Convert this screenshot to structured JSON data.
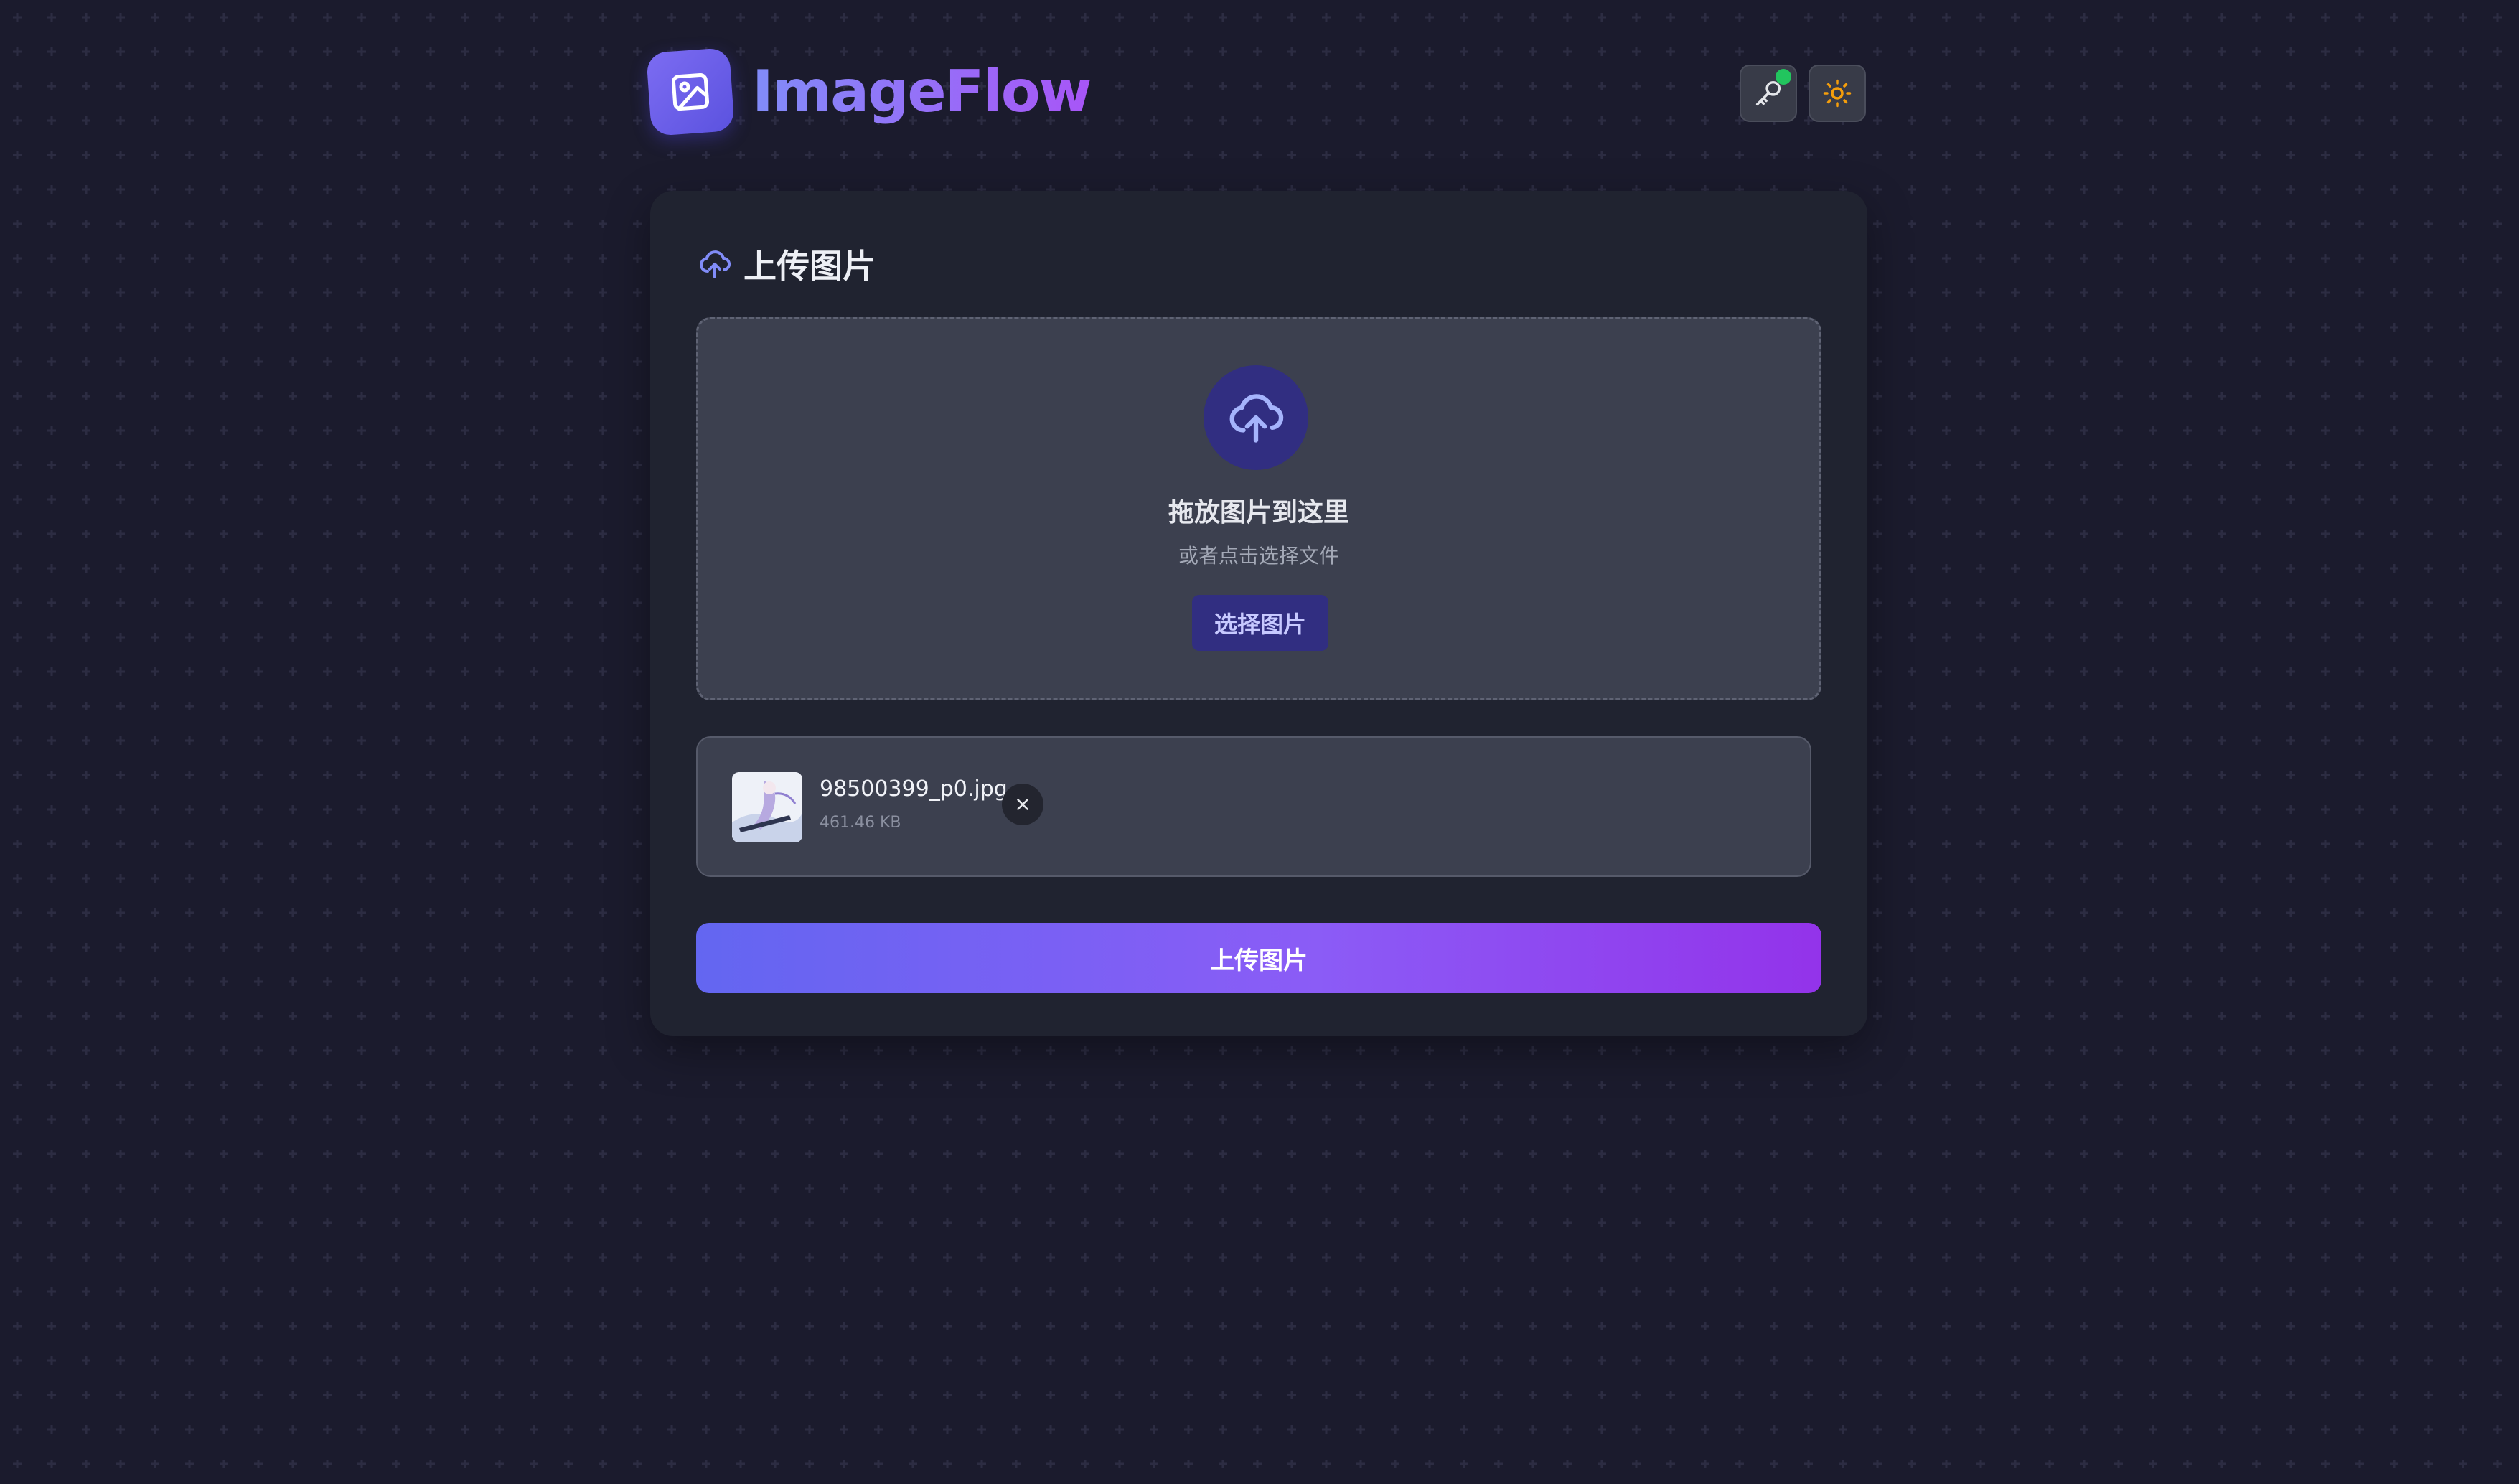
{
  "app": {
    "name": "ImageFlow"
  },
  "header": {
    "api_key_icon": "key-icon",
    "theme_icon": "sun-icon",
    "status_color": "#22c55e"
  },
  "upload_card": {
    "title": "上传图片",
    "title_icon": "cloud-upload-icon",
    "dropzone": {
      "icon": "cloud-upload-icon",
      "title": "拖放图片到这里",
      "subtitle": "或者点击选择文件",
      "select_button": "选择图片"
    },
    "files": [
      {
        "name": "98500399_p0.jpg",
        "size": "461.46 KB",
        "remove_icon": "close-icon"
      }
    ],
    "upload_button": "上传图片"
  },
  "colors": {
    "background": "#1b1b2d",
    "card": "#202330",
    "accent_start": "#6366f1",
    "accent_end": "#9333ea"
  }
}
